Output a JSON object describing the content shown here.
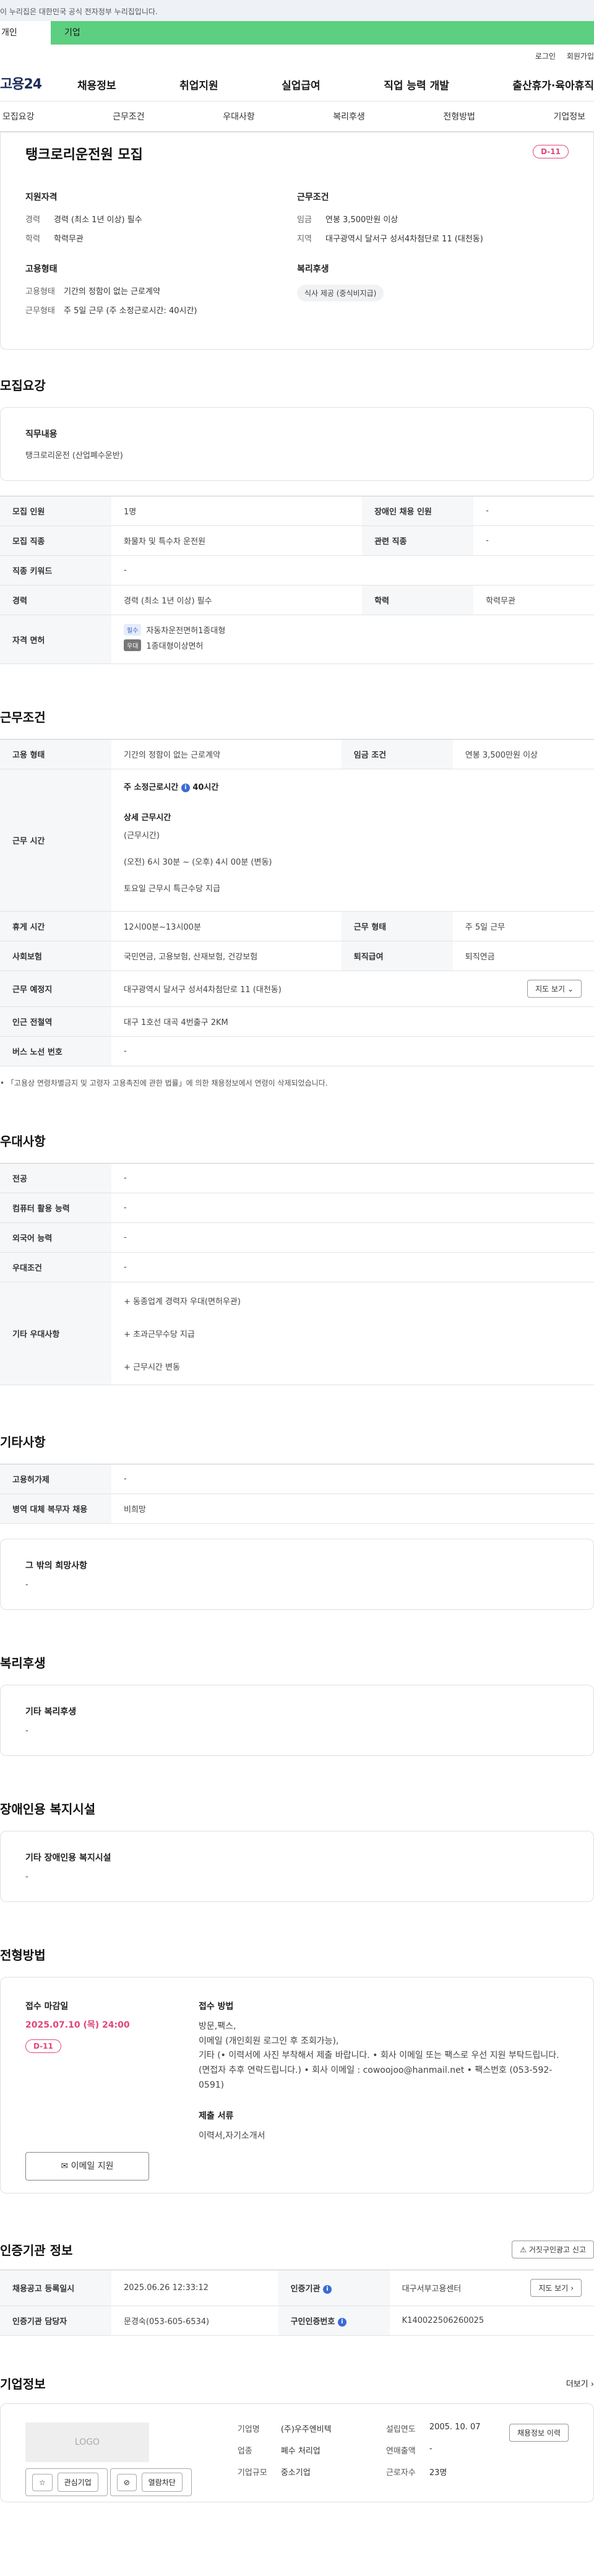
{
  "gov_bar": "이 누리집은 대한민국 공식 전자정부 누리집입니다.",
  "tabs": {
    "person": "개인",
    "company": "기업"
  },
  "util": {
    "login": "로그인",
    "signup": "회원가입"
  },
  "logo": "고용24",
  "nav": [
    "채용정보",
    "취업지원",
    "실업급여",
    "직업 능력 개발",
    "출산휴가·육아휴직"
  ],
  "subnav": [
    "모집요강",
    "근무조건",
    "우대사항",
    "복리후생",
    "전형방법",
    "기업정보"
  ],
  "top": {
    "title": "탱크로리운전원 모집",
    "dday": "D-11",
    "qual_h": "지원자격",
    "qual": [
      {
        "k": "경력",
        "v": "경력 (최소 1년 이상) 필수"
      },
      {
        "k": "학력",
        "v": "학력무관"
      }
    ],
    "cond_h": "근무조건",
    "cond": [
      {
        "k": "임금",
        "v": "연봉 3,500만원 이상"
      },
      {
        "k": "지역",
        "v": "대구광역시 달서구 성서4차첨단로 11 (대천동)"
      }
    ],
    "emp_h": "고용형태",
    "emp": [
      {
        "k": "고용형태",
        "v": "기간의 정함이 없는 근로계약"
      },
      {
        "k": "근무형태",
        "v": "주 5일 근무 (주 소정근로시간: 40시간)"
      }
    ],
    "welfare_h": "복리후생",
    "welfare_pill": "식사 제공 (중식비지급)"
  },
  "recruit": {
    "title": "모집요강",
    "duty_h": "직무내용",
    "duty_v": "탱크로리운전 (산업폐수운반)",
    "rows": [
      {
        "k1": "모집 인원",
        "v1": "1명",
        "k2": "장애인 채용 인원",
        "v2": "-"
      },
      {
        "k1": "모집 직종",
        "v1": "화물차 및 특수차 운전원",
        "k2": "관련 직종",
        "v2": "-"
      },
      {
        "k1": "직종 키워드",
        "v1": "-"
      },
      {
        "k1": "경력",
        "v1": "경력 (최소 1년 이상) 필수",
        "k2": "학력",
        "v2": "학력무관"
      }
    ],
    "license_h": "자격 면허",
    "licenses": [
      {
        "tag": "필수",
        "name": "자동차운전면허1종대형"
      },
      {
        "tag": "우대",
        "name": "1종대형이상면허"
      }
    ]
  },
  "work": {
    "title": "근무조건",
    "emp_type_h": "고용 형태",
    "emp_type_v": "기간의 정함이 없는 근로계약",
    "wage_h": "임금 조건",
    "wage_v": "연봉 3,500만원 이상",
    "time_h": "근무 시간",
    "weekly": "주 소정근로시간",
    "weekly_hours": "40시간",
    "detail_h": "상세 근무시간",
    "detail_lines": [
      "(근무시간)",
      "(오전) 6시 30분 ~ (오후) 4시 00분 (변동)",
      "토요일 근무시 특근수당 지급"
    ],
    "break_h": "휴게 시간",
    "break_v": "12시00분~13시00분",
    "form_h": "근무 형태",
    "form_v": "주 5일 근무",
    "ins_h": "사회보험",
    "ins_v": "국민연금, 고용보험, 산재보험, 건강보험",
    "sev_h": "퇴직급여",
    "sev_v": "퇴직연금",
    "place_h": "근무 예정지",
    "place_v": "대구광역시 달서구 성서4차첨단로 11 (대천동)",
    "map_btn": "지도 보기",
    "sub_h": "인근 전철역",
    "sub_v": "대구 1호선 대곡 4번출구 2KM",
    "bus_h": "버스 노선 번호",
    "bus_v": "-",
    "note": "「고용상 연령차별금지 및 고령자 고용촉진에 관한 법률」에 의한 채용정보에서 연령이 삭제되었습니다."
  },
  "pref": {
    "title": "우대사항",
    "rows": [
      {
        "k": "전공",
        "v": "-"
      },
      {
        "k": "컴퓨터 활용 능력",
        "v": "-"
      },
      {
        "k": "외국어 능력",
        "v": "-"
      },
      {
        "k": "우대조건",
        "v": "-"
      }
    ],
    "other_h": "기타 우대사항",
    "other_lines": [
      "+ 동종업계 경력자 우대(면허우관)",
      "+ 초과근무수당 지급",
      "+ 근무시간 변동"
    ]
  },
  "etc": {
    "title": "기타사항",
    "rows": [
      {
        "k": "고용허가제",
        "v": "-"
      },
      {
        "k": "병역 대체 복무자 채용",
        "v": "비희망"
      }
    ],
    "wish_h": "그 밖의 희망사항",
    "wish_v": "-"
  },
  "welfare": {
    "title": "복리후생",
    "h": "기타 복리후생",
    "v": "-"
  },
  "disability": {
    "title": "장애인용 복지시설",
    "h": "기타 장애인용 복지시설",
    "v": "-"
  },
  "selection": {
    "title": "전형방법",
    "deadline_h": "접수 마감일",
    "deadline_v": "2025.07.10 (목) 24:00",
    "dday": "D-11",
    "email_btn": "이메일 지원",
    "method_h": "접수 방법",
    "method_v": "방문,팩스,\n이메일 (개인회원 로그인 후 조회가능),\n기타 (• 이력서에 사진 부착해서 제출 바랍니다. • 회사 이메일 또는 팩스로 우선 지원 부탁드립니다. (면접자 추후 연락드립니다.) • 회사 이메일 : cowoojoo@hanmail.net • 팩스번호 (053-592-0591)",
    "docs_h": "제출 서류",
    "docs_v": "이력서,자기소개서"
  },
  "agency": {
    "title": "인증기관 정보",
    "report_btn": "거짓구인광고 신고",
    "reg_h": "채용공고 등록일시",
    "reg_v": "2025.06.26 12:33:12",
    "org_h": "인증기관",
    "org_v": "대구서부고용센터",
    "map_btn": "지도 보기",
    "mgr_h": "인증기관 담당자",
    "mgr_v": "문경숙(053-605-6534)",
    "num_h": "구인인증번호",
    "num_v": "K140022506260025"
  },
  "company": {
    "title": "기업정보",
    "more": "더보기",
    "logo": "LOGO",
    "fav_btn": "관심기업",
    "block_btn": "열람차단",
    "name_h": "기업명",
    "name_v": "(주)우주엔비텍",
    "est_h": "설립연도",
    "est_v": "2005. 10. 07",
    "ind_h": "업종",
    "ind_v": "폐수 처리업",
    "rev_h": "연매출액",
    "rev_v": "-",
    "size_h": "기업규모",
    "size_v": "중소기업",
    "emp_h": "근로자수",
    "emp_v": "23명",
    "jobs_btn": "채용정보 이력"
  }
}
